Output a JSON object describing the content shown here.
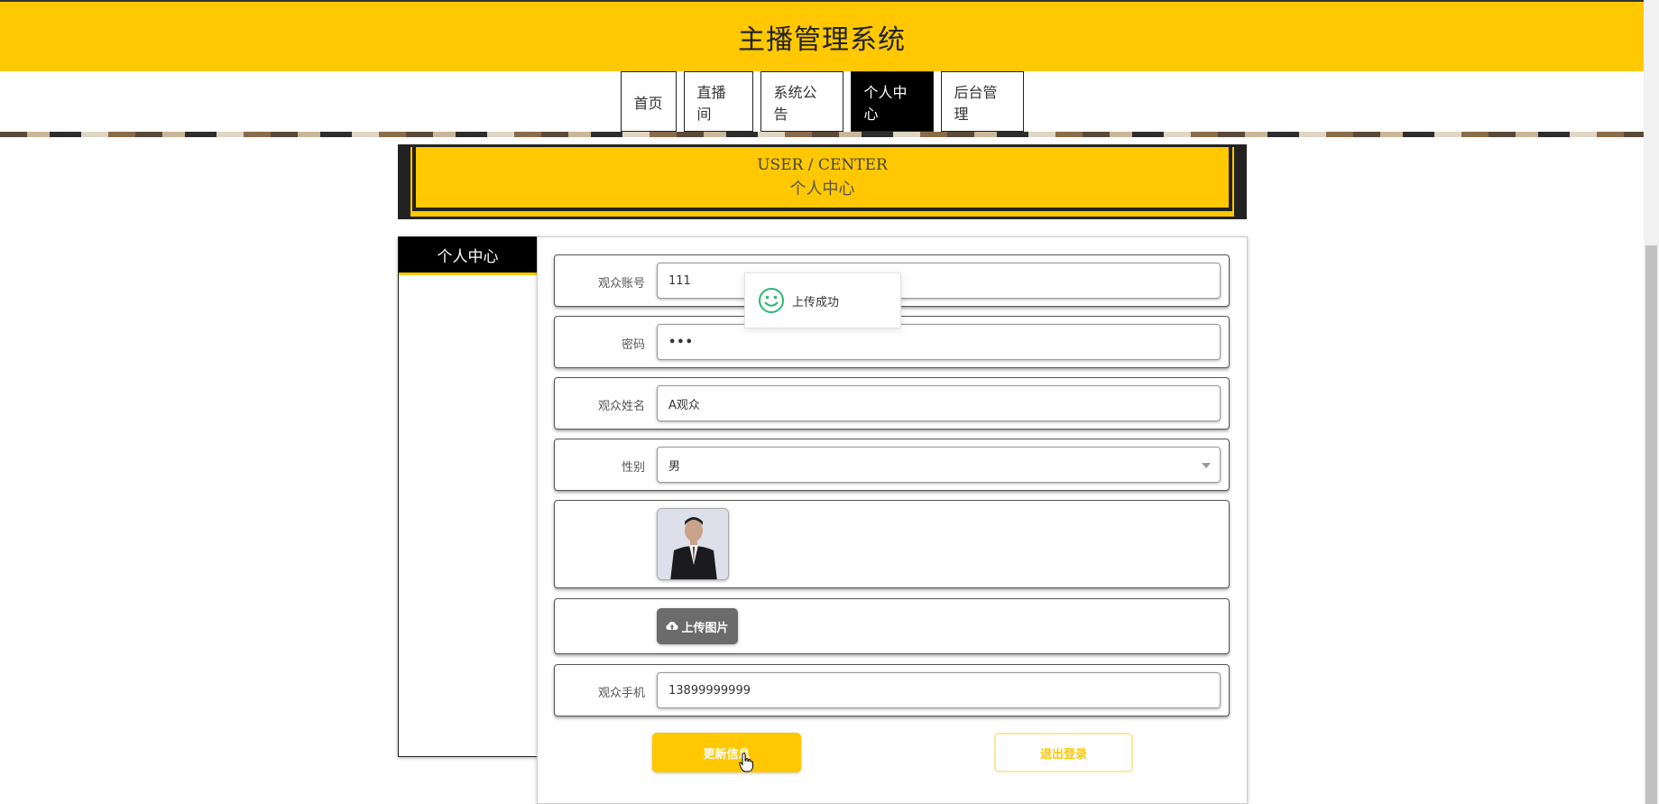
{
  "header": {
    "title": "主播管理系统"
  },
  "nav": {
    "items": [
      "首页",
      "直播间",
      "系统公告",
      "个人中心",
      "后台管理"
    ],
    "active_index": 3
  },
  "section": {
    "title_en": "USER / CENTER",
    "title_cn": "个人中心"
  },
  "sidebar": {
    "title": "个人中心"
  },
  "form": {
    "account_label": "观众账号",
    "account_value": "111",
    "password_label": "密码",
    "password_value": "•••",
    "name_label": "观众姓名",
    "name_value": "A观众",
    "gender_label": "性别",
    "gender_value": "男",
    "upload_label": "上传图片",
    "phone_label": "观众手机",
    "phone_value": "13899999999"
  },
  "actions": {
    "update_label": "更新信息",
    "logout_label": "退出登录"
  },
  "toast": {
    "message": "上传成功",
    "icon": "smile-icon"
  },
  "colors": {
    "accent": "#ffc800",
    "dark": "#000000",
    "toast_icon": "#2fb574"
  }
}
